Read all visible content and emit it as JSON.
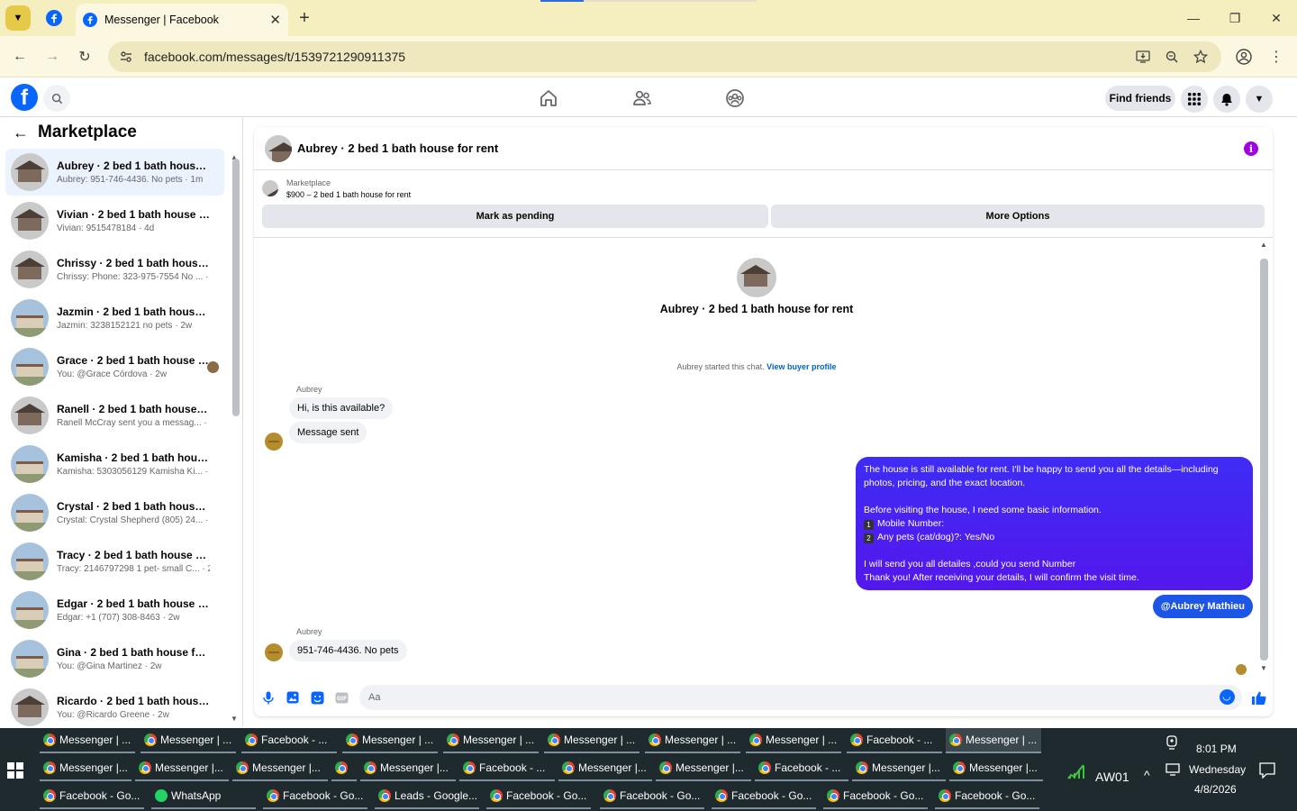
{
  "browser": {
    "tab_title": "Messenger | Facebook",
    "url": "facebook.com/messages/t/1539721290911375"
  },
  "header": {
    "find_friends": "Find friends"
  },
  "sidebar": {
    "title": "Marketplace",
    "conversations": [
      {
        "name": "Aubrey · 2 bed 1 bath house for...",
        "preview": "Aubrey: 951-746-4436. No pets · 1m",
        "thumb": "a"
      },
      {
        "name": "Vivian · 2 bed 1 bath house for r...",
        "preview": "Vivian: 9515478184 · 4d",
        "thumb": "a"
      },
      {
        "name": "Chrissy · 2 bed 1 bath house for...",
        "preview": "Chrissy: Phone: 323-975-7554 No ... · 4d",
        "thumb": "a"
      },
      {
        "name": "Jazmin · 2 bed 1 bath house for ...",
        "preview": "Jazmin: 3238152121 no pets · 2w",
        "thumb": "b"
      },
      {
        "name": "Grace · 2 bed 1 bath house fo...",
        "preview": "You: @Grace Córdova · 2w",
        "thumb": "b"
      },
      {
        "name": "Ranell · 2 bed 1 bath house for r...",
        "preview": "Ranell McCray sent you a messag... · 2w",
        "thumb": "a"
      },
      {
        "name": "Kamisha · 2 bed 1 bath house f...",
        "preview": "Kamisha: 5303056129 Kamisha Ki... · 2w",
        "thumb": "b"
      },
      {
        "name": "Crystal · 2 bed 1 bath house for ...",
        "preview": "Crystal: Crystal Shepherd (805) 24... · 2w",
        "thumb": "b"
      },
      {
        "name": "Tracy · 2 bed 1 bath house for r...",
        "preview": "Tracy: 2146797298 1 pet- small C... · 2w",
        "thumb": "b"
      },
      {
        "name": "Edgar · 2 bed 1 bath house for r...",
        "preview": "Edgar: +1 (707) 308-8463 · 2w",
        "thumb": "b"
      },
      {
        "name": "Gina · 2 bed 1 bath house for rent",
        "preview": "You: @Gina Martinez · 2w",
        "thumb": "b"
      },
      {
        "name": "Ricardo · 2 bed 1 bath house fo...",
        "preview": "You: @Ricardo Greene · 2w",
        "thumb": "a"
      }
    ]
  },
  "chat": {
    "title": "Aubrey · 2 bed 1 bath house for rent",
    "marketplace_label": "Marketplace",
    "listing": "$900 – 2 bed 1 bath house for rent",
    "mark_pending": "Mark as pending",
    "more_options": "More Options",
    "intro_name": "Aubrey · 2 bed 1 bath house for rent",
    "intro_note": "Aubrey started this chat.",
    "view_profile": "View buyer profile",
    "sender_1": "Aubrey",
    "msg_1": "Hi, is this available?",
    "msg_2": "Message sent",
    "out_lines": [
      "The house is still available for rent. I'll be happy to send you all the details—including",
      "photos, pricing, and the exact location.",
      "",
      "Before visiting the house, I need some basic information.",
      "Mobile Number:",
      "Any pets (cat/dog)?: Yes/No",
      "",
      "I will send you all detailes ,could you send Number",
      "Thank you! After receiving your details, I will confirm the visit time."
    ],
    "key_1": "1",
    "key_2": "2",
    "mention": "@Aubrey Mathieu",
    "sender_2": "Aubrey",
    "msg_3": "951-746-4436. No pets",
    "composer_placeholder": "Aa"
  },
  "taskbar": {
    "row1": [
      "Messenger | ...",
      "Messenger | ...",
      "Facebook - ...",
      "Messenger | ...",
      "Messenger | ...",
      "Messenger | ...",
      "Messenger | ...",
      "Messenger | ...",
      "Facebook - ...",
      "Messenger | ..."
    ],
    "row2": [
      "Messenger |...",
      "Messenger |...",
      "Messenger |...",
      "",
      "Messenger |...",
      "Facebook - ...",
      "Messenger |...",
      "Messenger |...",
      "Facebook - ...",
      "Messenger |...",
      "Messenger |..."
    ],
    "row3": [
      "Facebook - Go...",
      "WhatsApp",
      "Facebook - Go...",
      "Leads - Google...",
      "Facebook - Go...",
      "Facebook - Go...",
      "Facebook - Go...",
      "Facebook - Go...",
      "Facebook - Go..."
    ],
    "network_label": "AW01",
    "time": "8:01 PM",
    "day": "Wednesday",
    "date": "4/8/2026"
  }
}
